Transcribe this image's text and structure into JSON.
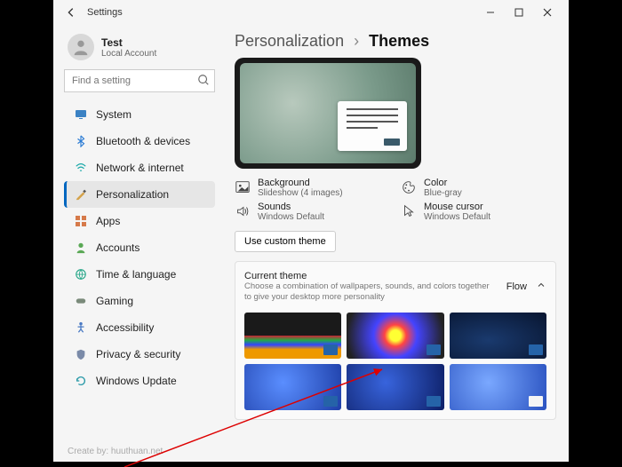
{
  "titlebar": {
    "title": "Settings"
  },
  "user": {
    "name": "Test",
    "type": "Local Account"
  },
  "search": {
    "placeholder": "Find a setting"
  },
  "nav": {
    "items": [
      {
        "label": "System"
      },
      {
        "label": "Bluetooth & devices"
      },
      {
        "label": "Network & internet"
      },
      {
        "label": "Personalization"
      },
      {
        "label": "Apps"
      },
      {
        "label": "Accounts"
      },
      {
        "label": "Time & language"
      },
      {
        "label": "Gaming"
      },
      {
        "label": "Accessibility"
      },
      {
        "label": "Privacy & security"
      },
      {
        "label": "Windows Update"
      }
    ]
  },
  "crumb": {
    "parent": "Personalization",
    "current": "Themes"
  },
  "settings": {
    "background": {
      "label": "Background",
      "value": "Slideshow (4 images)"
    },
    "color": {
      "label": "Color",
      "value": "Blue-gray"
    },
    "sounds": {
      "label": "Sounds",
      "value": "Windows Default"
    },
    "cursor": {
      "label": "Mouse cursor",
      "value": "Windows Default"
    }
  },
  "custom_button": "Use custom theme",
  "theme_section": {
    "title": "Current theme",
    "desc": "Choose a combination of wallpapers, sounds, and colors together to give your desktop more personality",
    "current": "Flow"
  },
  "credit": "Create by: huuthuan.net"
}
